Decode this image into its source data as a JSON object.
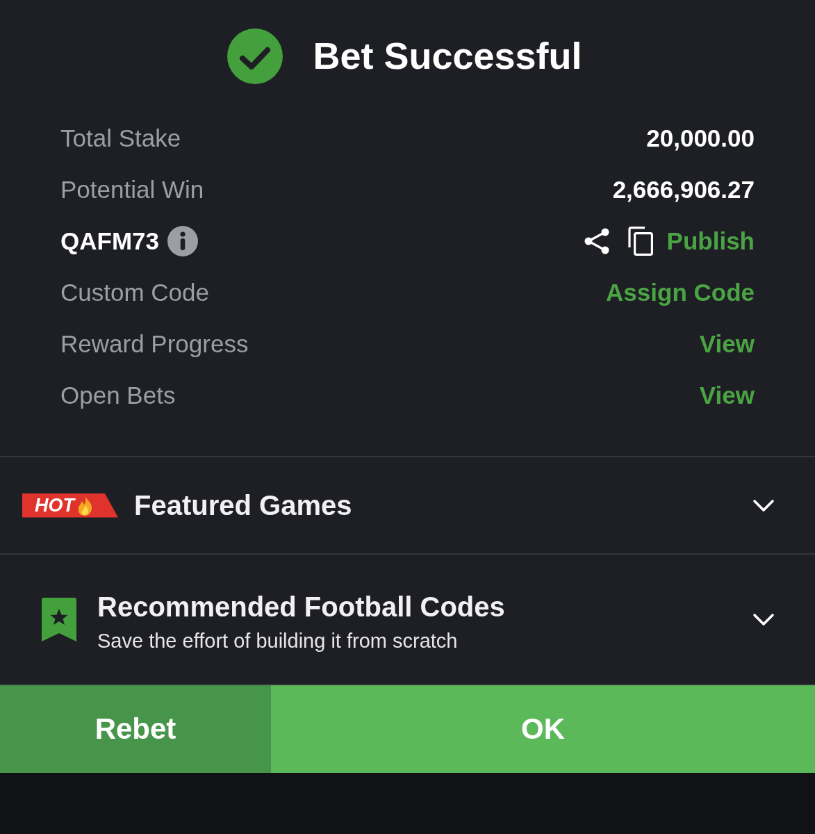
{
  "header": {
    "title": "Bet Successful"
  },
  "summary": [
    {
      "kind": "plain",
      "label": "Total Stake",
      "value": "20,000.00"
    },
    {
      "kind": "plain",
      "label": "Potential Win",
      "value": "2,666,906.27"
    },
    {
      "kind": "code",
      "label": "QAFM73",
      "value": "Publish"
    },
    {
      "kind": "link",
      "label": "Custom Code",
      "value": "Assign Code"
    },
    {
      "kind": "link",
      "label": "Reward Progress",
      "value": "View"
    },
    {
      "kind": "link",
      "label": "Open Bets",
      "value": "View"
    }
  ],
  "sections": [
    {
      "kind": "hot",
      "badge": "HOT",
      "title": "Featured Games",
      "expanded": false
    },
    {
      "kind": "bookmark",
      "title": "Recommended Football Codes",
      "subtitle": "Save the effort of building it from scratch",
      "expanded": false
    }
  ],
  "buttons": [
    {
      "kind": "secondary",
      "label": "Rebet"
    },
    {
      "kind": "primary",
      "label": "OK"
    }
  ]
}
